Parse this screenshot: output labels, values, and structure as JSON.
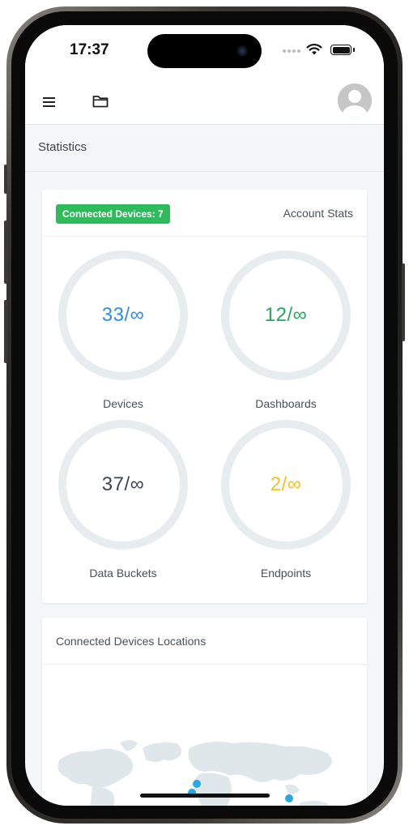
{
  "status_bar": {
    "time": "17:37"
  },
  "topbar": {
    "menu_icon": "menu-icon",
    "folder_icon": "folder-icon",
    "avatar_icon": "user-avatar-icon"
  },
  "page": {
    "title": "Statistics"
  },
  "stats_card": {
    "badge": "Connected Devices: 7",
    "heading": "Account Stats",
    "gauges": [
      {
        "value": "33/∞",
        "label": "Devices",
        "color": "#2f8ee5"
      },
      {
        "value": "12/∞",
        "label": "Dashboards",
        "color": "#26a65b"
      },
      {
        "value": "37/∞",
        "label": "Data Buckets",
        "color": "#3e4551"
      },
      {
        "value": "2/∞",
        "label": "Endpoints",
        "color": "#f1c21b"
      }
    ]
  },
  "map_card": {
    "title": "Connected Devices Locations",
    "marker_color": "#2aa8e0",
    "land_color": "#dfe7ea"
  }
}
